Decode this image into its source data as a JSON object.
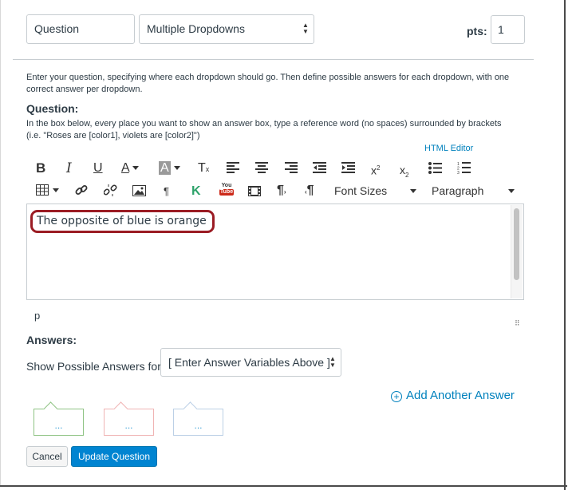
{
  "header": {
    "title_value": "Question",
    "type_value": "Multiple Dropdowns",
    "pts_label": "pts:",
    "pts_value": "1"
  },
  "intro_text": "Enter your question, specifying where each dropdown should go. Then define possible answers for each dropdown, with one correct answer per dropdown.",
  "question": {
    "label": "Question:",
    "help_line1": "In the box below, every place you want to show an answer box, type a reference word (no spaces) surrounded by brackets",
    "help_line2": "(i.e. \"Roses are [color1], violets are [color2]\")",
    "html_editor_link": "HTML Editor"
  },
  "toolbar": {
    "row1": [
      "bold-icon",
      "italic-icon",
      "underline-icon",
      "text-color-icon",
      "background-color-icon",
      "clear-formatting-icon",
      "align-left-icon",
      "align-center-icon",
      "align-right-icon",
      "outdent-icon",
      "indent-icon",
      "superscript-icon",
      "subscript-icon",
      "bullet-list-icon",
      "numbered-list-icon"
    ],
    "row2": [
      "table-icon",
      "link-icon",
      "unlink-icon",
      "image-icon",
      "paragraph-icon",
      "kaltura-icon",
      "youtube-icon",
      "media-icon",
      "ltr-icon",
      "rtl-icon"
    ],
    "font_sizes_label": "Font Sizes",
    "paragraph_label": "Paragraph",
    "youtube_top": "You",
    "youtube_bottom": "Tube"
  },
  "editor": {
    "content": "The opposite of blue is orange",
    "path": "p"
  },
  "answers": {
    "label": "Answers:",
    "show_label": "Show Possible Answers for",
    "variable_select": "[ Enter Answer Variables Above ]",
    "add_another": "Add Another Answer",
    "placeholder_dots": "..."
  },
  "buttons": {
    "cancel": "Cancel",
    "update": "Update Question"
  },
  "colors": {
    "accent": "#0081bd",
    "update_button": "#0084d1",
    "highlight_border": "#9b1c24"
  }
}
